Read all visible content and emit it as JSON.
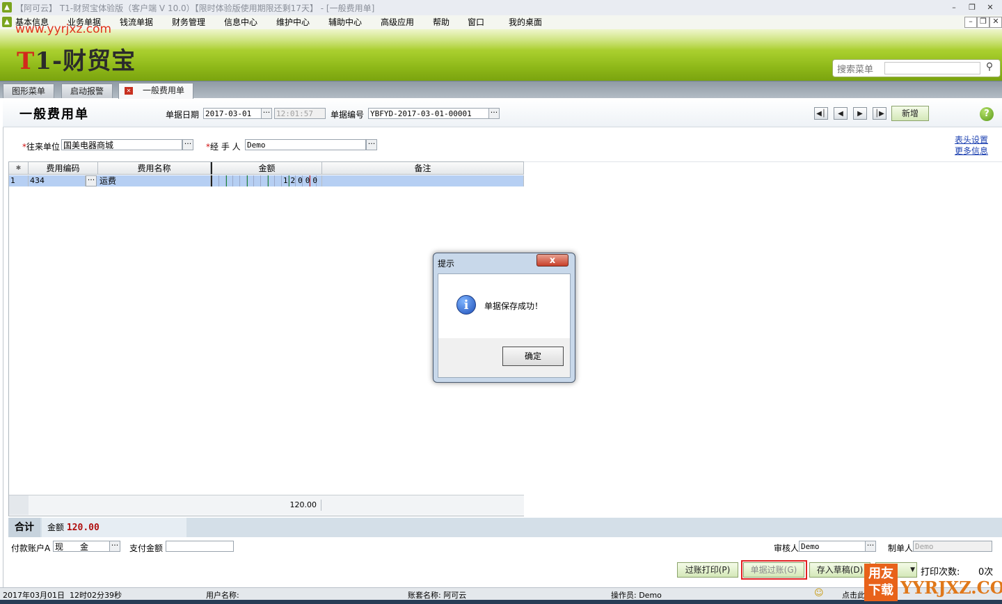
{
  "window": {
    "title": "【阿可云】 T1-财贸宝体验版（客户端 V 10.0）【限时体验版使用期限还剩17天】 - [一般费用单]"
  },
  "menu": [
    "基本信息",
    "业务单据",
    "钱流单据",
    "财务管理",
    "信息中心",
    "维护中心",
    "辅助中心",
    "高级应用",
    "帮助",
    "窗口",
    "我的桌面"
  ],
  "banner": {
    "url": "www.yyrjxz.com",
    "logo_a": "T",
    "logo_b": "1-财贸宝",
    "search_label": "搜索菜单"
  },
  "tabs": [
    "图形菜单",
    "启动报警",
    "一般费用单"
  ],
  "doc": {
    "title": "一般费用单",
    "date_label": "单据日期",
    "date_value": "2017-03-01",
    "time_value": "12:01:57",
    "number_label": "单据编号",
    "number_value": "YBFYD-2017-03-01-00001",
    "new_button": "新增",
    "partner_label": "往来单位",
    "partner_value": "国美电器商城",
    "handler_label": "经 手 人",
    "handler_value": "Demo",
    "link_header": "表头设置",
    "link_more": "更多信息"
  },
  "grid": {
    "columns": [
      "",
      "费用编码",
      "费用名称",
      "金额",
      "备注"
    ],
    "rows": [
      {
        "index": "1",
        "code": "434",
        "name": "运费",
        "amount": "12000",
        "note": ""
      }
    ],
    "footer_total": "120.00"
  },
  "totals": {
    "label": "合计",
    "amount_label": "金额",
    "amount_value": "120.00"
  },
  "payment": {
    "account_label": "付款账户A",
    "account_value": "现　　金",
    "pay_label": "支付金额",
    "auditor_label": "审核人",
    "auditor_value": "Demo",
    "maker_label": "制单人",
    "maker_value": "Demo"
  },
  "actions": {
    "post_print": "过账打印(P)",
    "post": "单据过账(G)",
    "draft": "存入草稿(D)",
    "print_count_label": "打印次数:",
    "print_count_value": "0次"
  },
  "status": {
    "date": "2017年03月01日",
    "time": "12时02分39秒",
    "user_label": "用户名称:",
    "account_label": "账套名称: 阿可云",
    "operator_label": "操作员: Demo",
    "hint": "点击此"
  },
  "dialog": {
    "title": "提示",
    "close": "x",
    "message": "单据保存成功！",
    "ok": "确定"
  },
  "watermark": {
    "box": "用友下载",
    "text": "YYRJXZ.COM"
  }
}
